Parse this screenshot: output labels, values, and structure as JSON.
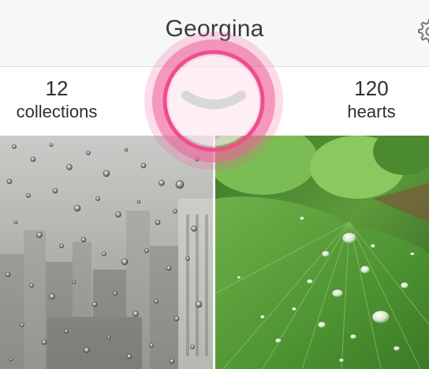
{
  "header": {
    "profile_name": "Georgina",
    "settings_icon": "gear-icon"
  },
  "stats": {
    "collections": {
      "count": "12",
      "label": "collections"
    },
    "hearts": {
      "count": "120",
      "label": "hearts"
    }
  },
  "toggle": {
    "icon": "chevron-down-icon",
    "highlight_color": "#f0609a",
    "chevron_color": "#d8d8d8"
  },
  "photos": [
    {
      "subject": "raindrops-on-window"
    },
    {
      "subject": "water-drops-on-green-leaf"
    }
  ],
  "colors": {
    "header_bg": "#f7f7f7",
    "stats_bg": "#ffffff",
    "text": "#333333"
  }
}
